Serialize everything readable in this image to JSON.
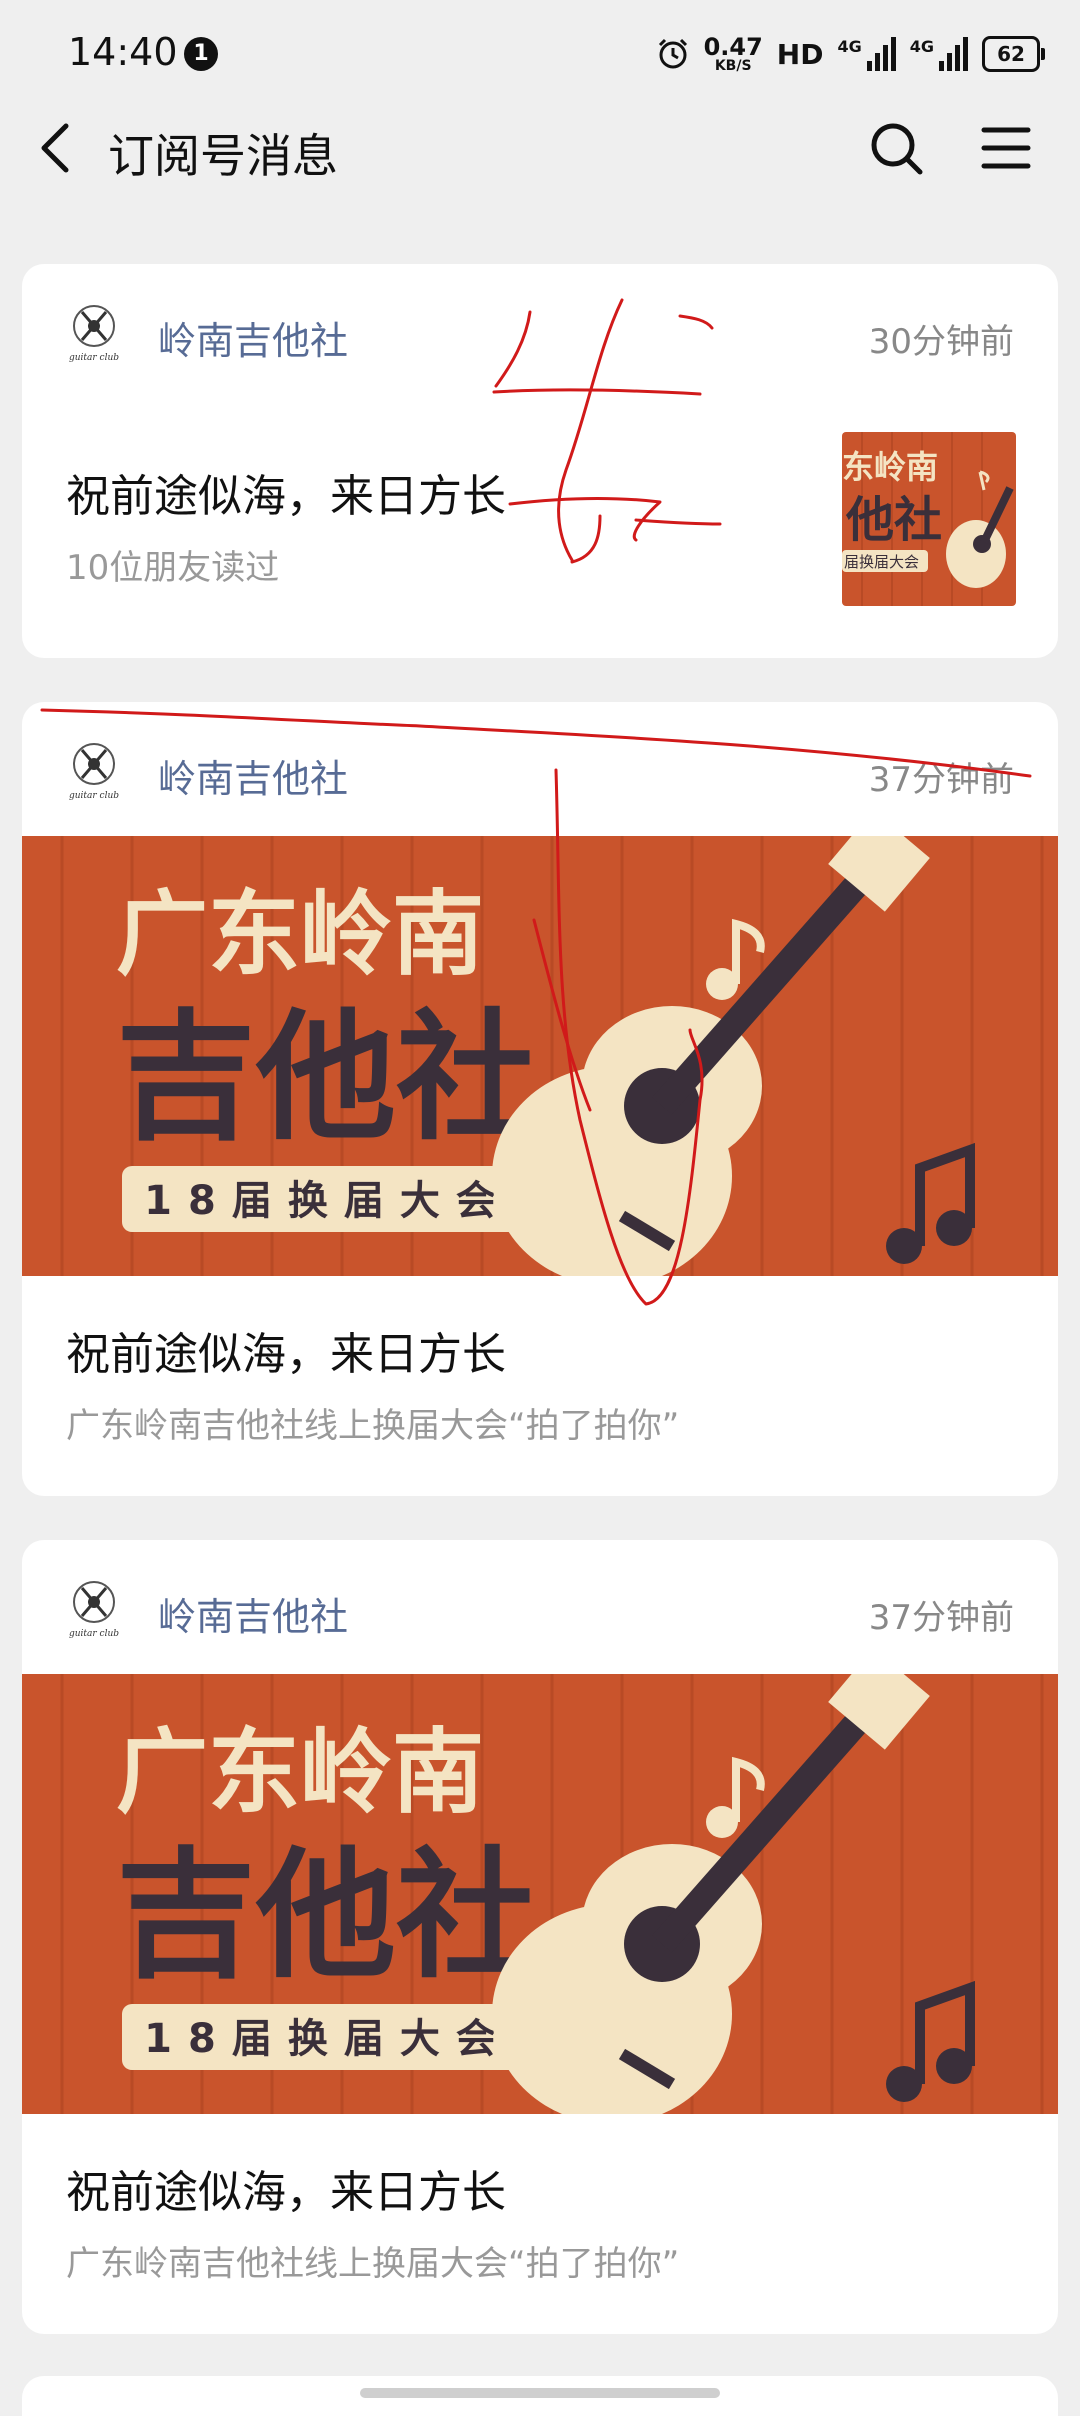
{
  "status_bar": {
    "time": "14:40",
    "notification_count": "1",
    "net_speed_value": "0.47",
    "net_speed_unit": "KB/S",
    "hd_label": "HD",
    "network_1": "4G",
    "network_2": "4G",
    "battery": "62"
  },
  "nav": {
    "title": "订阅号消息"
  },
  "colors": {
    "account_name": "#576b95",
    "banner_bg": "#c9542c",
    "banner_text_cream": "#f4e4c3",
    "banner_text_dark": "#3a2f3a",
    "annotation_red": "#d11a1a"
  },
  "cards": [
    {
      "account": "岭南吉他社",
      "time": "30分钟前",
      "title": "祝前途似海，来日方长",
      "subtitle": "10位朋友读过",
      "thumb_line1": "东岭南",
      "thumb_line2": "他社",
      "thumb_line3": "届换届大会"
    },
    {
      "account": "岭南吉他社",
      "time": "37分钟前",
      "title": "祝前途似海，来日方长",
      "subtitle": "广东岭南吉他社线上换届大会“拍了拍你”",
      "banner_line1": "广东岭南",
      "banner_line2": "吉他社",
      "banner_tag": "18届换届大会"
    },
    {
      "account": "岭南吉他社",
      "time": "37分钟前",
      "title": "祝前途似海，来日方长",
      "subtitle": "广东岭南吉他社线上换届大会“拍了拍你”",
      "banner_line1": "广东岭南",
      "banner_line2": "吉他社",
      "banner_tag": "18届换届大会"
    }
  ],
  "avatar_caption": "guitar club"
}
